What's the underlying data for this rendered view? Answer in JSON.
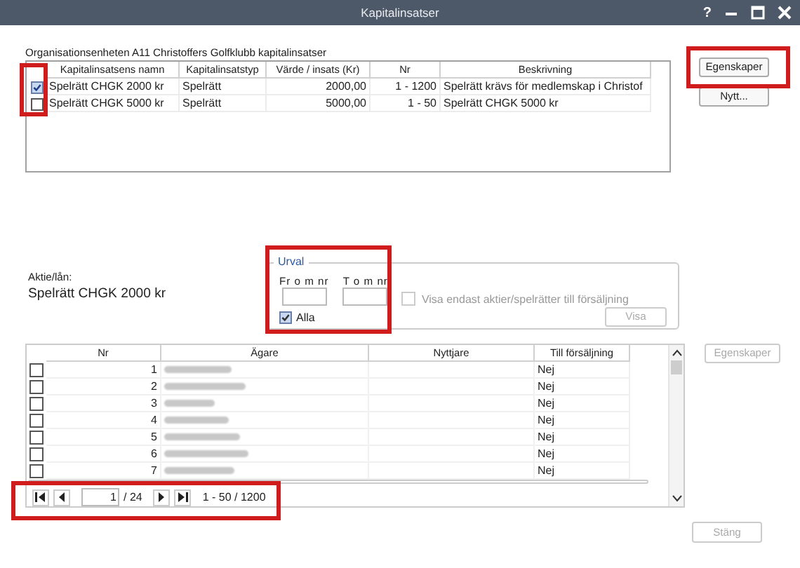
{
  "window": {
    "title": "Kapitalinsatser",
    "help": "?"
  },
  "heading": "Organisationsenheten A11 Christoffers Golfklubb kapitalinsatser",
  "top_table": {
    "columns": [
      "Kapitalinsatsens namn",
      "Kapitalinsatstyp",
      "Värde / insats (Kr)",
      "Nr",
      "Beskrivning"
    ],
    "rows": [
      {
        "checked": true,
        "cells": [
          "Spelrätt CHGK 2000 kr",
          "Spelrätt",
          "2000,00",
          "1 - 1200",
          "Spelrätt krävs för medlemskap i Christof"
        ]
      },
      {
        "checked": false,
        "cells": [
          "Spelrätt CHGK 5000 kr",
          "Spelrätt",
          "5000,00",
          "1 - 50",
          "Spelrätt CHGK 5000 kr"
        ]
      }
    ]
  },
  "side_buttons": [
    {
      "label": "Egenskaper",
      "disabled": false
    },
    {
      "label": "Nytt...",
      "disabled": false
    }
  ],
  "aktie": {
    "label": "Aktie/lån:",
    "value": "Spelrätt CHGK 2000 kr"
  },
  "urval": {
    "title": "Urval",
    "from_label": "Fr o m nr",
    "to_label": "T o m nr",
    "alla": {
      "label": "Alla",
      "checked": true
    },
    "only_for_sale": {
      "label": "Visa endast aktier/spelrätter till försäljning",
      "checked": false,
      "disabled": true
    },
    "show_button": {
      "label": "Visa",
      "disabled": true
    }
  },
  "bottom_table": {
    "columns": [
      "Nr",
      "Ägare",
      "Nyttjare",
      "Till försäljning"
    ],
    "rows": [
      {
        "checked": false,
        "nr": "1",
        "for_sale": "Nej"
      },
      {
        "checked": false,
        "nr": "2",
        "for_sale": "Nej"
      },
      {
        "checked": false,
        "nr": "3",
        "for_sale": "Nej"
      },
      {
        "checked": false,
        "nr": "4",
        "for_sale": "Nej"
      },
      {
        "checked": false,
        "nr": "5",
        "for_sale": "Nej"
      },
      {
        "checked": false,
        "nr": "6",
        "for_sale": "Nej"
      },
      {
        "checked": false,
        "nr": "7",
        "for_sale": "Nej"
      }
    ]
  },
  "pager": {
    "page": "1",
    "pages": "/ 24",
    "range": "1 - 50 / 1200"
  },
  "bottom_side_button": {
    "label": "Egenskaper",
    "disabled": true
  },
  "close_button": {
    "label": "Stäng",
    "disabled": true
  }
}
